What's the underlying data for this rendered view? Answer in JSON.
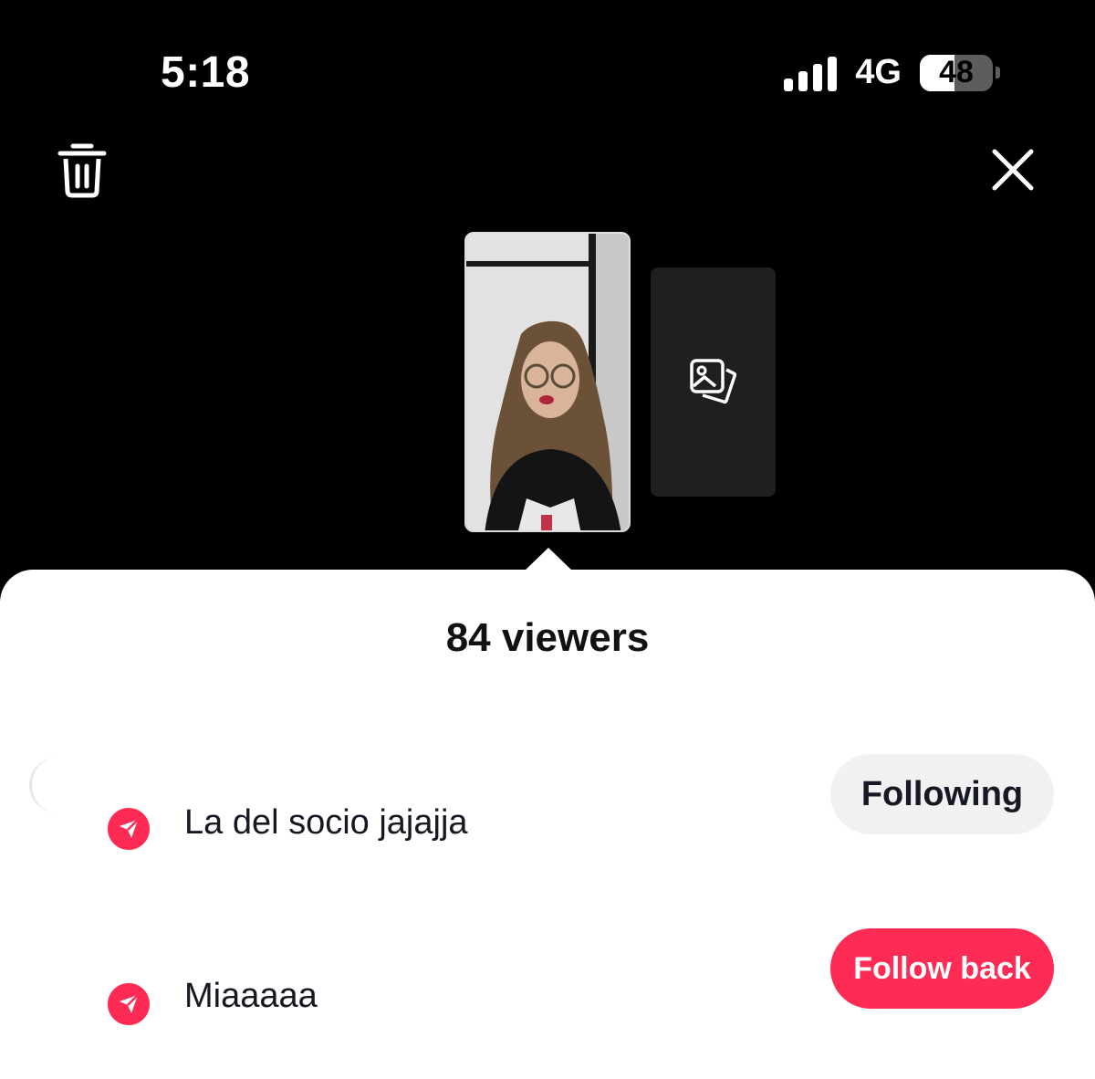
{
  "status_bar": {
    "time": "5:18",
    "network": "4G",
    "battery": "48",
    "battery_level": 0.48
  },
  "top_bar": {
    "delete_icon": "trash-icon",
    "close_icon": "close-icon"
  },
  "stories": {
    "add_icon": "photo-gallery-icon"
  },
  "sheet": {
    "title": "84 viewers",
    "viewers": [
      {
        "name": "La del socio jajajja",
        "action": "Following",
        "badge_icon": "send-icon"
      },
      {
        "name": "Miaaaaa",
        "action": "Follow back",
        "badge_icon": "send-icon"
      }
    ]
  },
  "colors": {
    "accent": "#fe2c55",
    "sheet_bg": "#ffffff",
    "app_bg": "#000000"
  }
}
